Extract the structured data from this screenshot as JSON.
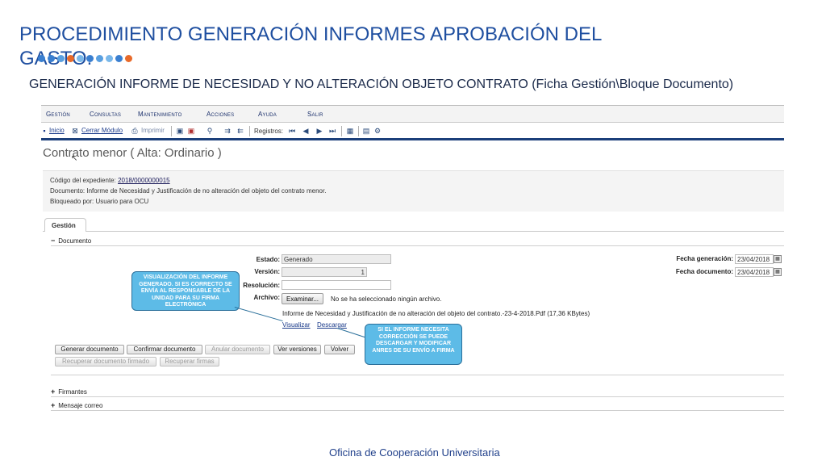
{
  "slide": {
    "title": "PROCEDIMIENTO GENERACIÓN INFORMES APROBACIÓN DEL GASTO.",
    "subtitle": "GENERACIÓN INFORME DE NECESIDAD Y NO ALTERACIÓN OBJETO CONTRATO (Ficha Gestión\\Bloque Documento)",
    "footer": "Oficina de Cooperación Universitaria",
    "dot_colors": [
      "#3a7fd0",
      "#3a7fd0",
      "#5aa0e0",
      "#e86a2a",
      "#7ab8ea",
      "#3a7fd0",
      "#5aa0e0",
      "#7ab8ea",
      "#3a7fd0",
      "#e86a2a"
    ]
  },
  "menubar": {
    "items": [
      "Gestión",
      "Consultas",
      "Mantenimiento",
      "Acciones",
      "Ayuda",
      "Salir"
    ]
  },
  "toolbar": {
    "inicio": "Inicio",
    "cerrar_modulo": "Cerrar Módulo",
    "imprimir": "Imprimir",
    "registros": "Registros:"
  },
  "page": {
    "title": "Contrato menor ( Alta: Ordinario )"
  },
  "info": {
    "codigo_label": "Código del expediente:",
    "codigo_value": "2018/0000000015",
    "documento": "Documento: Informe de Necesidad y Justificación de no alteración del objeto del contrato menor.",
    "bloqueado": "Bloqueado por: Usuario para OCU"
  },
  "tabs": {
    "gestion": "Gestión"
  },
  "documento": {
    "section_label": "Documento",
    "estado_label": "Estado:",
    "estado_value": "Generado",
    "version_label": "Versión:",
    "version_value": "1",
    "resolucion_label": "Resolución:",
    "resolucion_value": "",
    "archivo_label": "Archivo:",
    "examinar": "Examinar...",
    "no_file": "No se ha seleccionado ningún archivo.",
    "file_name": "Informe de Necesidad y Justificación de no alteración del objeto del contrato.-23-4-2018.Pdf (17,36 KBytes)",
    "visualizar": "Visualizar",
    "descargar": "Descargar",
    "fecha_generacion_label": "Fecha generación:",
    "fecha_generacion_value": "23/04/2018",
    "fecha_documento_label": "Fecha documento:",
    "fecha_documento_value": "23/04/2018"
  },
  "buttons": {
    "generar": "Generar documento",
    "confirmar": "Confirmar documento",
    "anular": "Anular documento",
    "ver_versiones": "Ver versiones",
    "volver": "Volver",
    "recuperar_firmado": "Recuperar documento firmado",
    "recuperar_firmas": "Recuperar firmas"
  },
  "sections": {
    "firmantes": "Firmantes",
    "mensaje": "Mensaje correo"
  },
  "callouts": {
    "visualizacion": "VISUALIZACIÓN DEL INFORME GENERADO. SI ES CORRECTO SE ENVÍA AL RESPONSABLE DE LA UNIDAD PARA SU FIRMA ELECTRÓNICA",
    "descarga": "SI EL INFORME NECESITA CORRECCIÓN SE PUEDE DESCARGAR Y MODIFICAR ANRES DE SU ENVÍO A FIRMA"
  }
}
